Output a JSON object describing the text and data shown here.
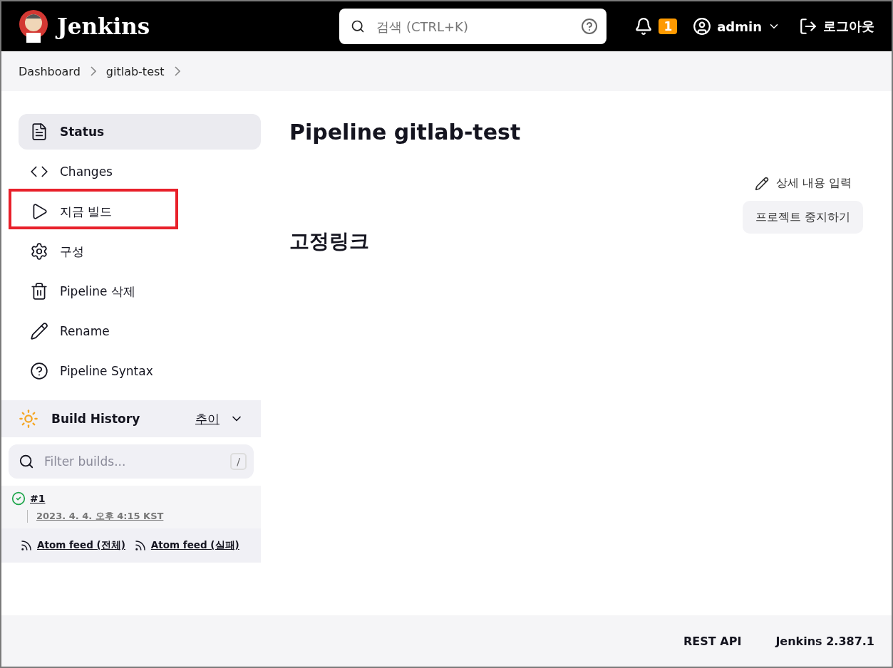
{
  "header": {
    "logo": "Jenkins",
    "search": {
      "placeholder": "검색 (CTRL+K)"
    },
    "notifications": "1",
    "user": "admin",
    "logout": "로그아웃"
  },
  "breadcrumbs": [
    "Dashboard",
    "gitlab-test"
  ],
  "sidebar": {
    "items": [
      {
        "label": "Status",
        "kind": "doc",
        "selected": true,
        "highlighted": false
      },
      {
        "label": "Changes",
        "kind": "code",
        "selected": false,
        "highlighted": false
      },
      {
        "label": "지금 빌드",
        "kind": "play",
        "selected": false,
        "highlighted": true
      },
      {
        "label": "구성",
        "kind": "gear",
        "selected": false,
        "highlighted": false
      },
      {
        "label": "Pipeline 삭제",
        "kind": "trash",
        "selected": false,
        "highlighted": false
      },
      {
        "label": "Rename",
        "kind": "pencil",
        "selected": false,
        "highlighted": false
      },
      {
        "label": "Pipeline Syntax",
        "kind": "help",
        "selected": false,
        "highlighted": false
      }
    ]
  },
  "build_history": {
    "title": "Build History",
    "trend": "추이",
    "filter": {
      "placeholder": "Filter builds...",
      "shortcut": "/"
    },
    "builds": [
      {
        "number": "#1",
        "date": "2023. 4. 4. 오후 4:15 KST",
        "kind": "success"
      }
    ],
    "feeds": [
      "Atom feed (전체)",
      "Atom feed (실패)"
    ]
  },
  "main": {
    "title": "Pipeline gitlab-test",
    "edit_description": "상세 내용 입력",
    "disable_button": "프로젝트 중지하기",
    "permalinks_title": "고정링크"
  },
  "footer": {
    "links": [
      "REST API",
      "Jenkins 2.387.1"
    ]
  }
}
